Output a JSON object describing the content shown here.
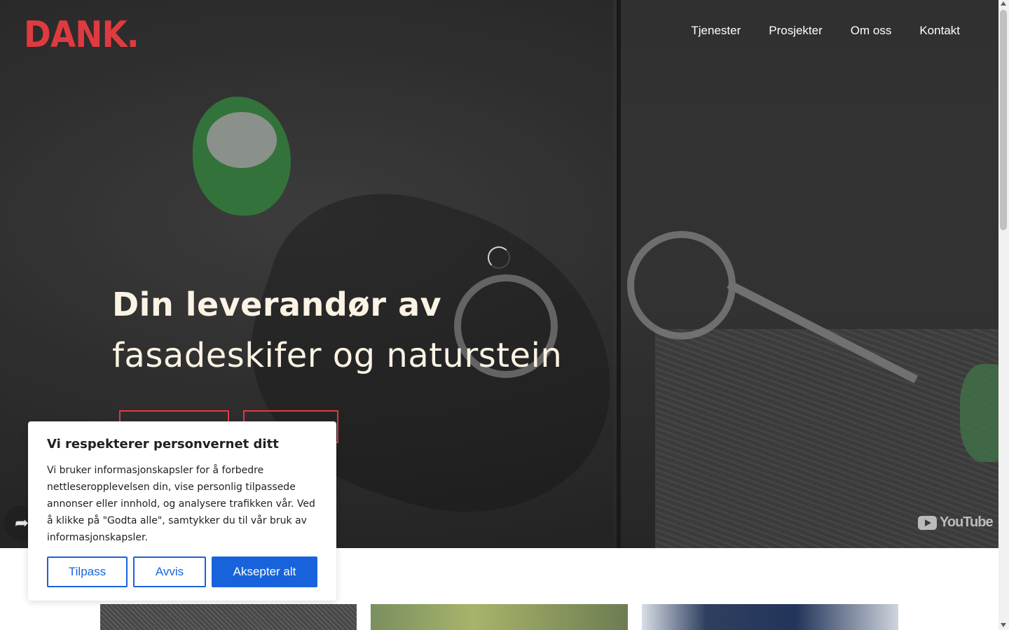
{
  "header": {
    "logo_text": "DANK.",
    "nav": [
      {
        "label": "Tjenester"
      },
      {
        "label": "Prosjekter"
      },
      {
        "label": "Om oss"
      },
      {
        "label": "Kontakt"
      }
    ]
  },
  "hero": {
    "headline_line1": "Din leverandør av",
    "headline_line2": "fasadeskifer og naturstein",
    "youtube_label": "YouTube"
  },
  "cookie_banner": {
    "title": "Vi respekterer personvernet ditt",
    "body": "Vi bruker informasjonskapsler for å forbedre nettleseropplevelsen din, vise personlig tilpassede annonser eller innhold, og analysere trafikken vår. Ved å klikke på \"Godta alle\", samtykker du til vår bruk av informasjonskapsler.",
    "buttons": {
      "customize": "Tilpass",
      "reject": "Avvis",
      "accept_all": "Aksepter alt"
    }
  },
  "colors": {
    "brand_red": "#e03a41",
    "headline_cream": "#fbf3e4",
    "cookie_blue": "#1863dc"
  },
  "icons": {
    "share": "share-arrow-icon",
    "youtube": "youtube-logo-icon",
    "loading": "loading-spinner-icon"
  }
}
